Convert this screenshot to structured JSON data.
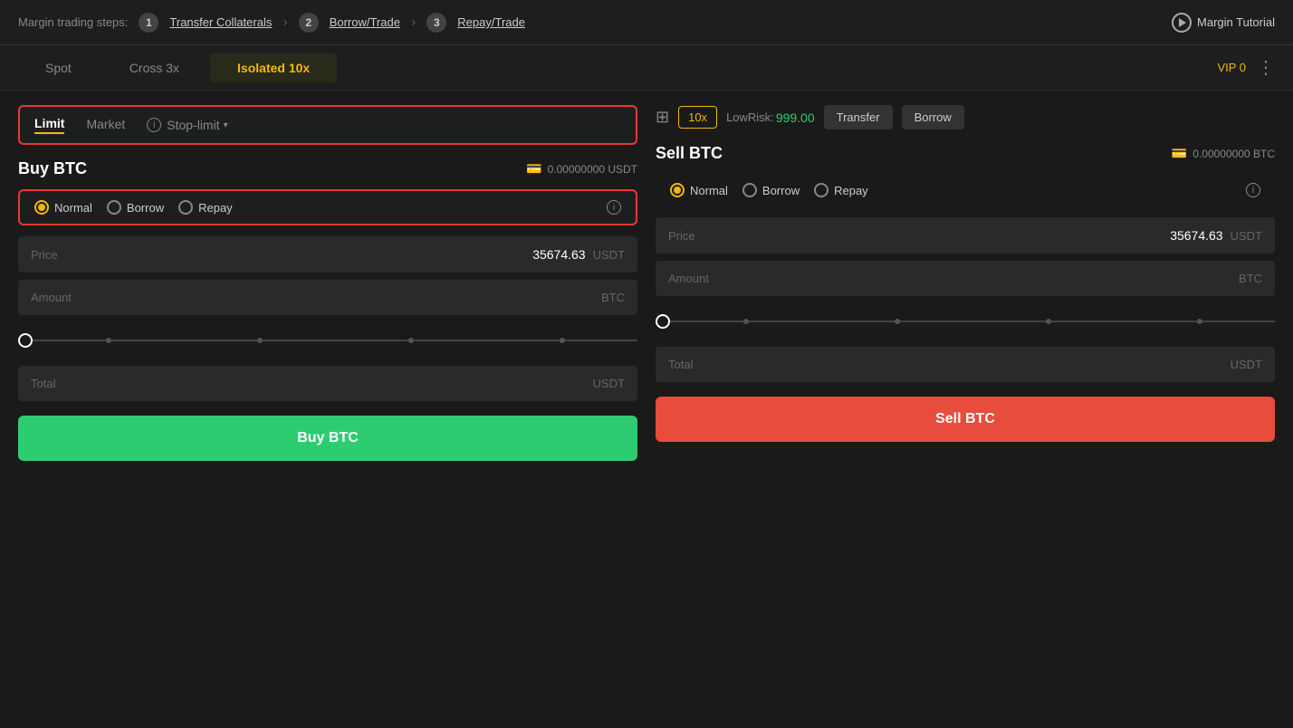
{
  "topBar": {
    "label": "Margin trading steps:",
    "step1": {
      "number": "1",
      "link": "Transfer Collaterals"
    },
    "step2": {
      "number": "2",
      "link": "Borrow/Trade"
    },
    "step3": {
      "number": "3",
      "link": "Repay/Trade"
    },
    "tutorial": "Margin Tutorial"
  },
  "tabs": {
    "spot": "Spot",
    "cross": "Cross 3x",
    "isolated": "Isolated",
    "isolatedLeverage": "10x",
    "vip": "VIP 0"
  },
  "orderType": {
    "limit": "Limit",
    "market": "Market",
    "stopLimit": "Stop-limit"
  },
  "rightToolbar": {
    "leverage": "10x",
    "lowRiskLabel": "LowRisk:",
    "lowRiskValue": "999.00",
    "transferBtn": "Transfer",
    "borrowBtn": "Borrow"
  },
  "buyPanel": {
    "title": "Buy BTC",
    "balance": "0.00000000 USDT",
    "modes": {
      "normal": "Normal",
      "borrow": "Borrow",
      "repay": "Repay"
    },
    "price": {
      "label": "Price",
      "value": "35674.63",
      "currency": "USDT"
    },
    "amount": {
      "label": "Amount",
      "value": "",
      "currency": "BTC"
    },
    "total": {
      "label": "Total",
      "value": "",
      "currency": "USDT"
    },
    "actionBtn": "Buy BTC"
  },
  "sellPanel": {
    "title": "Sell BTC",
    "balance": "0.00000000 BTC",
    "modes": {
      "normal": "Normal",
      "borrow": "Borrow",
      "repay": "Repay"
    },
    "price": {
      "label": "Price",
      "value": "35674.63",
      "currency": "USDT"
    },
    "amount": {
      "label": "Amount",
      "value": "",
      "currency": "BTC"
    },
    "total": {
      "label": "Total",
      "value": "",
      "currency": "USDT"
    },
    "actionBtn": "Sell BTC"
  },
  "colors": {
    "accent": "#f0b90b",
    "buy": "#2ecc71",
    "sell": "#e74c3c",
    "highlight": "#e53935",
    "bg": "#1a1a1a",
    "panelBg": "#1e1e1e"
  }
}
